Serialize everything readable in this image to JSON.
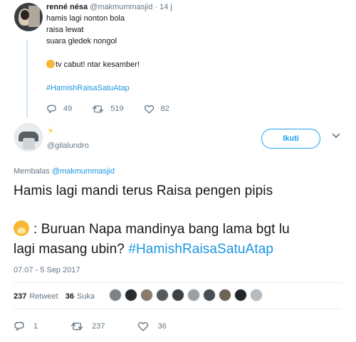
{
  "parent_tweet": {
    "name": "renné nésa",
    "handle": "@makmummasjid",
    "separator": "·",
    "time": "14 j",
    "lines": [
      "hamis lagi nonton bola",
      "raisa lewat",
      "suara gledek nongol"
    ],
    "emoji_line": "tv cabut! ntar kesamber!",
    "hashtag": "#HamishRaisaSatuAtap",
    "reply_count": "49",
    "retweet_count": "519",
    "like_count": "82"
  },
  "main_tweet": {
    "display_name_emoji": "⚡",
    "handle": "@gilalundro",
    "follow_label": "Ikuti",
    "reply_prefix": "Membalas",
    "reply_to": "@makmummasjid",
    "line1": "Hamis lagi mandi terus Raisa pengen pipis",
    "line2": ": Buruan Napa mandinya bang lama bgt lu",
    "line3": "lagi masang ubin?",
    "hashtag": "#HamishRaisaSatuAtap",
    "timestamp": "07.07 - 5 Sep 2017",
    "retweets_num": "237",
    "retweets_label": "Retweet",
    "likes_num": "36",
    "likes_label": "Suka",
    "reply_count": "1",
    "retweet_count": "237",
    "like_count": "36"
  },
  "colors": {
    "accent": "#1da1f2",
    "link": "#1b95e0",
    "muted": "#657786",
    "retweet_icon": "#657786",
    "emoji": "#f7b733",
    "thread_line": "#cde6f7"
  },
  "likers": [
    {
      "color": "#7d8287"
    },
    {
      "color": "#2b2b2b"
    },
    {
      "color": "#8a7b6b"
    },
    {
      "color": "#55595c"
    },
    {
      "color": "#3d3f41"
    },
    {
      "color": "#9aa0a4"
    },
    {
      "color": "#4a4d50"
    },
    {
      "color": "#6e6252"
    },
    {
      "color": "#242628"
    },
    {
      "color": "#b6bbbf"
    }
  ]
}
